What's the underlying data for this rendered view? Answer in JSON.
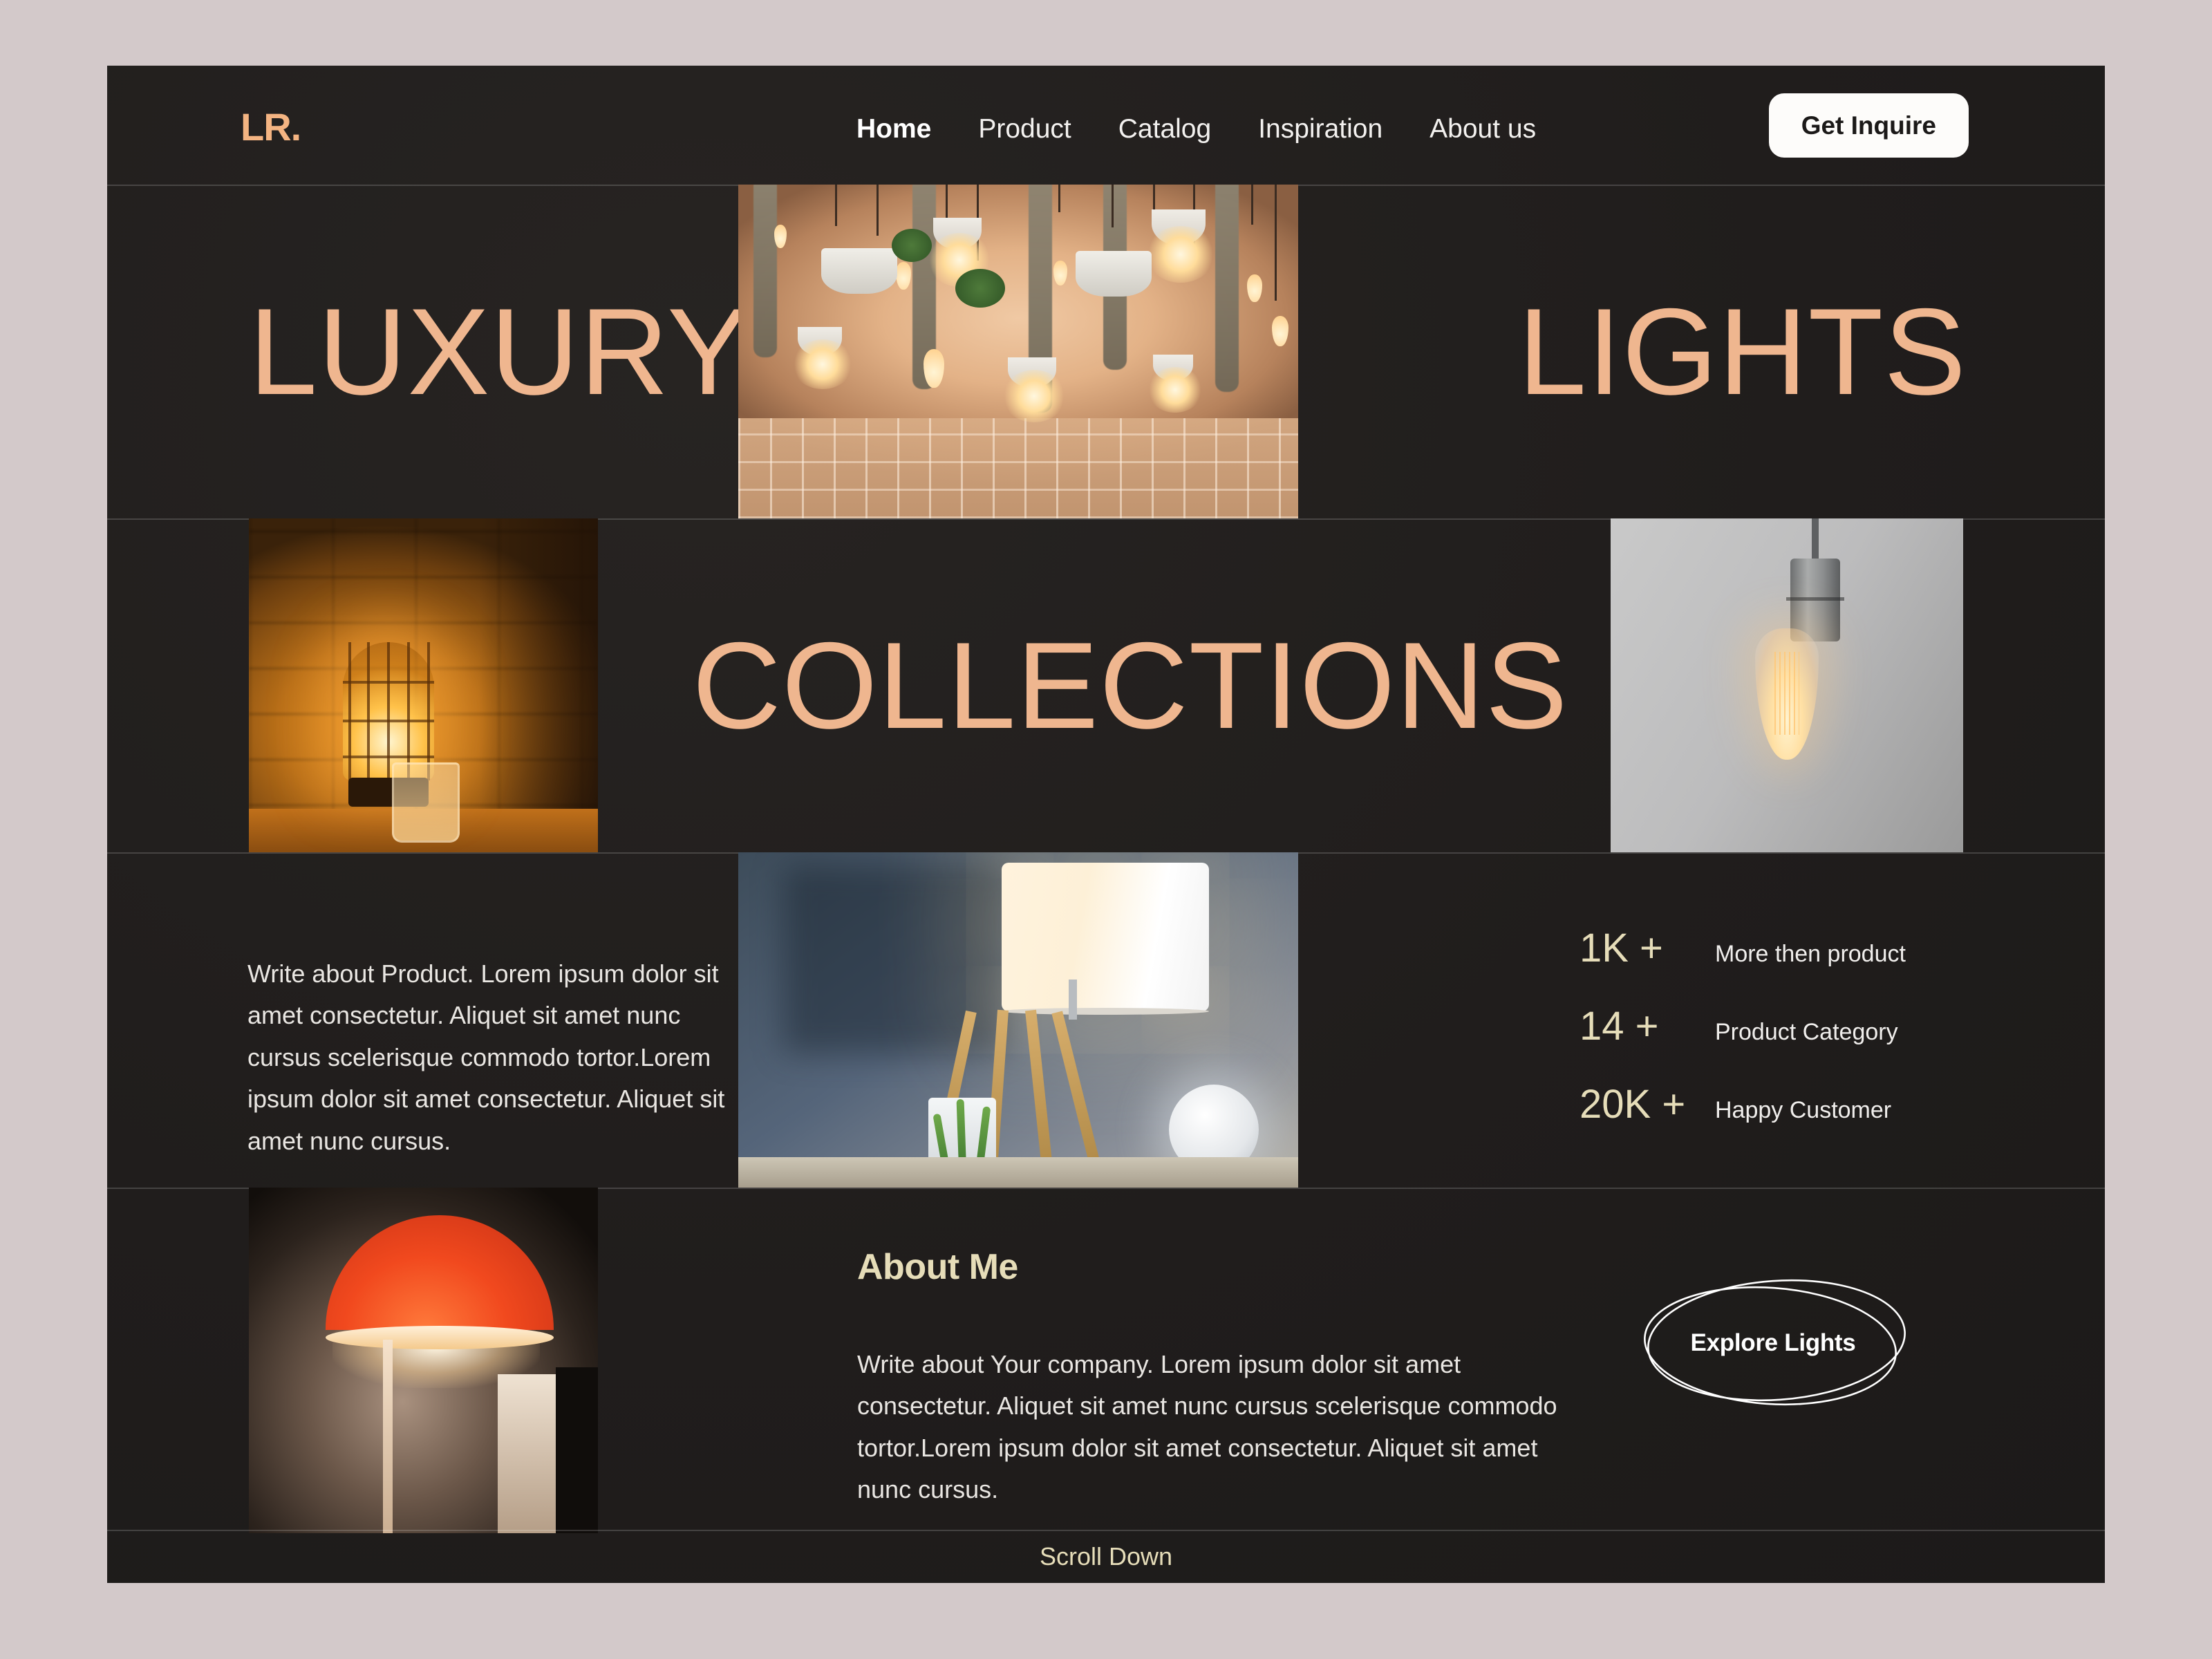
{
  "brand": {
    "logo": "LR."
  },
  "nav": {
    "items": [
      {
        "label": "Home",
        "active": true
      },
      {
        "label": "Product",
        "active": false
      },
      {
        "label": "Catalog",
        "active": false
      },
      {
        "label": "Inspiration",
        "active": false
      },
      {
        "label": "About us",
        "active": false
      }
    ],
    "cta": "Get Inquire"
  },
  "hero": {
    "word_left": "LUXURY",
    "word_right": "LIGHTS",
    "image_alt": "hanging-pendant-lights-with-plants"
  },
  "collections": {
    "title": "COLLECTIONS",
    "image_left_alt": "caged-edison-lamp-on-brick-wall",
    "image_right_alt": "hanging-edison-bulb-on-grey-wall"
  },
  "product": {
    "description": "Write about Product.  Lorem ipsum dolor sit amet consectetur. Aliquet sit amet nunc cursus scelerisque commodo tortor.Lorem ipsum dolor sit amet consectetur. Aliquet sit amet nunc cursus.",
    "image_alt": "wooden-tripod-table-lamp-with-plant-and-moon-lamp",
    "stats": [
      {
        "value": "1K +",
        "label": "More then product"
      },
      {
        "value": "14 +",
        "label": "Product Category"
      },
      {
        "value": "20K +",
        "label": "Happy Customer"
      }
    ]
  },
  "about": {
    "heading": "About Me",
    "body": "Write about Your company.  Lorem ipsum dolor sit amet consectetur. Aliquet sit amet nunc cursus scelerisque commodo tortor.Lorem ipsum dolor sit amet consectetur. Aliquet sit amet nunc cursus.",
    "image_alt": "red-dome-table-lamp-in-dark-room",
    "cta": "Explore Lights"
  },
  "footer": {
    "scroll_label": "Scroll Down"
  },
  "colors": {
    "page_background": "#d3c9ca",
    "card_background": "#221f1e",
    "accent_peach": "#efb68f",
    "accent_cream": "#e6ddb9",
    "text_light": "#e9e6e2",
    "button_background": "#fdfcfa",
    "button_text": "#1b1918"
  }
}
